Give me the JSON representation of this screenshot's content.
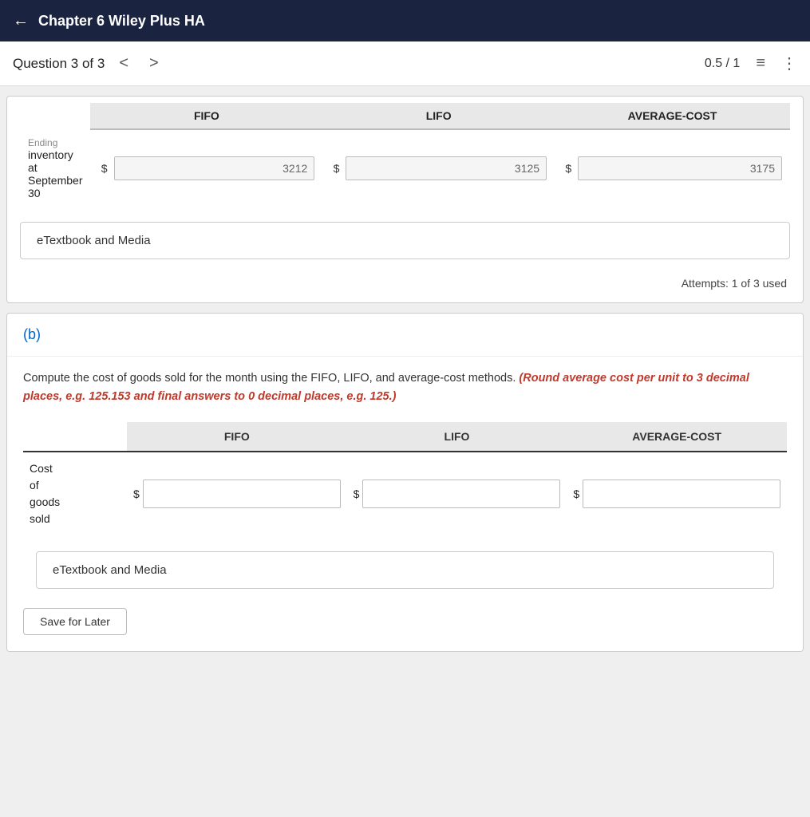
{
  "topbar": {
    "back_label": "←",
    "title": "Chapter 6 Wiley Plus HA"
  },
  "question_nav": {
    "label": "Question 3 of 3",
    "prev_arrow": "<",
    "next_arrow": ">",
    "score": "0.5 / 1",
    "list_icon": "≡",
    "more_icon": "⋮"
  },
  "part_a": {
    "table": {
      "headers": [
        "FIFO",
        "LIFO",
        "AVERAGE-COST"
      ],
      "row_label": "Ending inventory at September 30",
      "fifo_value": "3212",
      "lifo_value": "3125",
      "avg_value": "3175",
      "dollar_sign": "$"
    },
    "etextbook_label": "eTextbook and Media",
    "attempts_label": "Attempts: 1 of 3 used"
  },
  "part_b": {
    "label": "(b)",
    "instruction_plain": "Compute the cost of goods sold for the month using the FIFO, LIFO, and average-cost methods.",
    "instruction_highlight": "(Round average cost per unit to 3 decimal places, e.g. 125.153 and final answers to 0 decimal places, e.g. 125.)",
    "table": {
      "headers": [
        "FIFO",
        "LIFO",
        "AVERAGE-COST"
      ],
      "row_label_line1": "Cost",
      "row_label_line2": "of",
      "row_label_line3": "goods",
      "row_label_line4": "sold",
      "dollar_sign": "$",
      "fifo_placeholder": "",
      "lifo_placeholder": "",
      "avg_placeholder": ""
    },
    "etextbook_label": "eTextbook and Media",
    "save_label": "Save for Later"
  }
}
